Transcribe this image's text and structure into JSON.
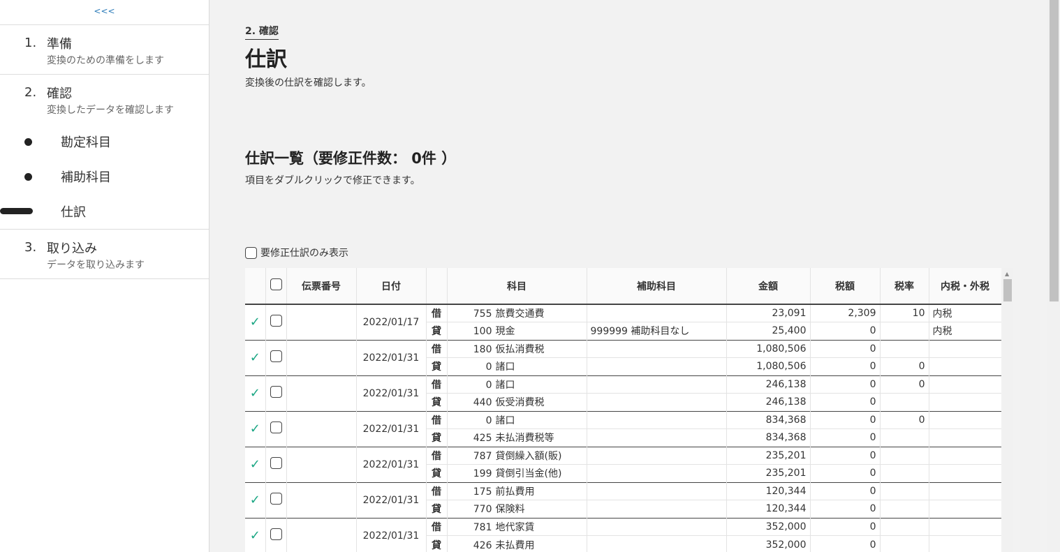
{
  "sidebar": {
    "collapse_label": "<<<",
    "steps": [
      {
        "num": "1.",
        "title": "準備",
        "desc": "変換のための準備をします"
      },
      {
        "num": "2.",
        "title": "確認",
        "desc": "変換したデータを確認します"
      },
      {
        "num": "3.",
        "title": "取り込み",
        "desc": "データを取り込みます"
      }
    ],
    "sub_items": [
      {
        "label": "勘定科目"
      },
      {
        "label": "補助科目"
      },
      {
        "label": "仕訳"
      }
    ]
  },
  "main": {
    "breadcrumb": "2. 確認",
    "title": "仕訳",
    "description": "変換後の仕訳を確認します。",
    "section_title": "仕訳一覧（要修正件数： 0件 ）",
    "section_desc": "項目をダブルクリックで修正できます。",
    "filter_label": "要修正仕訳のみ表示"
  },
  "table": {
    "headers": [
      "",
      "",
      "伝票番号",
      "日付",
      "",
      "科目",
      "補助科目",
      "金額",
      "税額",
      "税率",
      "内税・外税"
    ],
    "entries": [
      {
        "date": "2022/01/17",
        "voucher": "",
        "lines": [
          {
            "drcr": "借",
            "code": "755",
            "account": "旅費交通費",
            "sub": "",
            "amount": "23,091",
            "tax": "2,309",
            "rate": "10",
            "taxtype": "内税"
          },
          {
            "drcr": "貸",
            "code": "100",
            "account": "現金",
            "sub": "999999 補助科目なし",
            "amount": "25,400",
            "tax": "0",
            "rate": "",
            "taxtype": "内税"
          }
        ]
      },
      {
        "date": "2022/01/31",
        "voucher": "",
        "lines": [
          {
            "drcr": "借",
            "code": "180",
            "account": "仮払消費税",
            "sub": "",
            "amount": "1,080,506",
            "tax": "0",
            "rate": "",
            "taxtype": ""
          },
          {
            "drcr": "貸",
            "code": "0",
            "account": "諸口",
            "sub": "",
            "amount": "1,080,506",
            "tax": "0",
            "rate": "0",
            "taxtype": ""
          }
        ]
      },
      {
        "date": "2022/01/31",
        "voucher": "",
        "lines": [
          {
            "drcr": "借",
            "code": "0",
            "account": "諸口",
            "sub": "",
            "amount": "246,138",
            "tax": "0",
            "rate": "0",
            "taxtype": ""
          },
          {
            "drcr": "貸",
            "code": "440",
            "account": "仮受消費税",
            "sub": "",
            "amount": "246,138",
            "tax": "0",
            "rate": "",
            "taxtype": ""
          }
        ]
      },
      {
        "date": "2022/01/31",
        "voucher": "",
        "lines": [
          {
            "drcr": "借",
            "code": "0",
            "account": "諸口",
            "sub": "",
            "amount": "834,368",
            "tax": "0",
            "rate": "0",
            "taxtype": ""
          },
          {
            "drcr": "貸",
            "code": "425",
            "account": "未払消費税等",
            "sub": "",
            "amount": "834,368",
            "tax": "0",
            "rate": "",
            "taxtype": ""
          }
        ]
      },
      {
        "date": "2022/01/31",
        "voucher": "",
        "lines": [
          {
            "drcr": "借",
            "code": "787",
            "account": "貸倒繰入額(販)",
            "sub": "",
            "amount": "235,201",
            "tax": "0",
            "rate": "",
            "taxtype": ""
          },
          {
            "drcr": "貸",
            "code": "199",
            "account": "貸倒引当金(他)",
            "sub": "",
            "amount": "235,201",
            "tax": "0",
            "rate": "",
            "taxtype": ""
          }
        ]
      },
      {
        "date": "2022/01/31",
        "voucher": "",
        "lines": [
          {
            "drcr": "借",
            "code": "175",
            "account": "前払費用",
            "sub": "",
            "amount": "120,344",
            "tax": "0",
            "rate": "",
            "taxtype": ""
          },
          {
            "drcr": "貸",
            "code": "770",
            "account": "保険料",
            "sub": "",
            "amount": "120,344",
            "tax": "0",
            "rate": "",
            "taxtype": ""
          }
        ]
      },
      {
        "date": "2022/01/31",
        "voucher": "",
        "lines": [
          {
            "drcr": "借",
            "code": "781",
            "account": "地代家賃",
            "sub": "",
            "amount": "352,000",
            "tax": "0",
            "rate": "",
            "taxtype": ""
          },
          {
            "drcr": "貸",
            "code": "426",
            "account": "未払費用",
            "sub": "",
            "amount": "352,000",
            "tax": "0",
            "rate": "",
            "taxtype": ""
          }
        ]
      }
    ]
  },
  "colors": {
    "check": "#1aa683",
    "link": "#2a7ab8",
    "background": "#f2f2f2"
  }
}
